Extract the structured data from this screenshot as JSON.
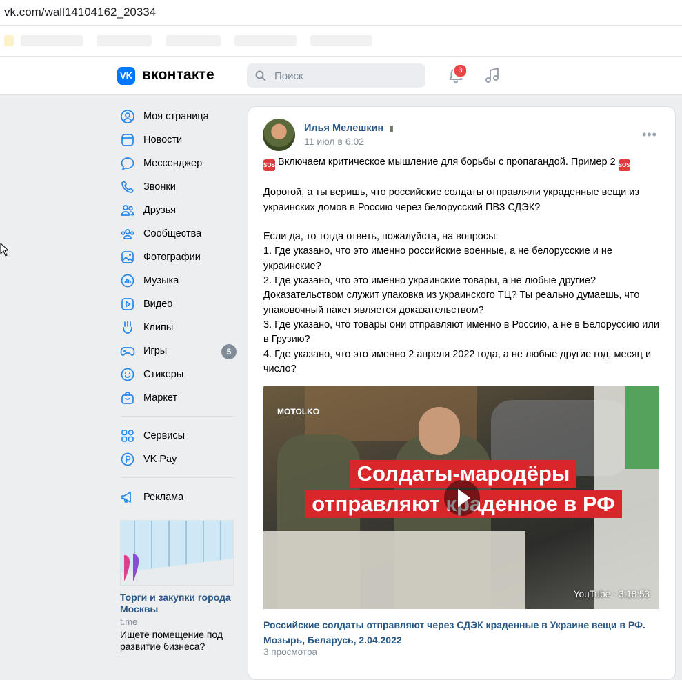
{
  "browser": {
    "url": "vk.com/wall14104162_20334"
  },
  "header": {
    "logo_text": "вконтакте",
    "logo_mark": "VK",
    "search_placeholder": "Поиск",
    "notifications_count": "3"
  },
  "sidebar": {
    "items": [
      {
        "label": "Моя страница",
        "icon": "user-circle-icon"
      },
      {
        "label": "Новости",
        "icon": "news-icon"
      },
      {
        "label": "Мессенджер",
        "icon": "message-icon"
      },
      {
        "label": "Звонки",
        "icon": "phone-icon"
      },
      {
        "label": "Друзья",
        "icon": "friends-icon"
      },
      {
        "label": "Сообщества",
        "icon": "communities-icon"
      },
      {
        "label": "Фотографии",
        "icon": "photo-icon"
      },
      {
        "label": "Музыка",
        "icon": "music-icon"
      },
      {
        "label": "Видео",
        "icon": "video-icon"
      },
      {
        "label": "Клипы",
        "icon": "clips-icon"
      },
      {
        "label": "Игры",
        "icon": "games-icon",
        "count": "5"
      },
      {
        "label": "Стикеры",
        "icon": "stickers-icon"
      },
      {
        "label": "Маркет",
        "icon": "market-icon"
      }
    ],
    "items2": [
      {
        "label": "Сервисы",
        "icon": "services-icon"
      },
      {
        "label": "VK Pay",
        "icon": "vkpay-icon"
      }
    ],
    "items3": [
      {
        "label": "Реклама",
        "icon": "megaphone-icon"
      }
    ],
    "ad": {
      "title": "Торги и закупки города Москвы",
      "domain": "t.me",
      "description": "Ищете помещение под развитие бизнеса?"
    }
  },
  "post": {
    "author": "Илья Мелешкин",
    "date": "11 июл в 6:02",
    "sos_label": "SOS",
    "headline": " Включаем критическое мышление для борьбы с пропагандой. Пример 2 ",
    "paragraph1": "Дорогой, а ты веришь, что российские солдаты отправляли украденные вещи из украинских домов в Россию через белорусский ПВЗ СДЭК?",
    "questions_intro": "Если да, то тогда ответь, пожалуйста, на вопросы:",
    "q1": "1. Где указано, что это именно российские военные, а не белорусские и не украинские?",
    "q2": "2. Где указано, что это именно украинские товары, а не любые другие? Доказательством служит упаковка из украинского ТЦ? Ты реально думаешь, что упаковочный пакет является доказательством?",
    "q3": "3. Где указано, что товары они отправляют именно в Россию, а не в Белоруссию или в Грузию?",
    "q4": "4. Где указано, что это именно 2 апреля 2022 года, а не любые другие год, месяц и число?",
    "video": {
      "watermark": "MOTOLKO",
      "caption_line1": "Солдаты-мародёры",
      "caption_line2": "отправляют краденное в РФ",
      "duration": "YouTube · 3:18:53",
      "title": "Российские солдаты отправляют через СДЭК краденные в Украине вещи в РФ. Мозырь, Беларусь, 2.04.2022",
      "views": "3 просмотра"
    }
  },
  "colors": {
    "accent": "#0077ff",
    "link": "#2a5885",
    "badge": "#e64646",
    "background": "#edeef0"
  }
}
